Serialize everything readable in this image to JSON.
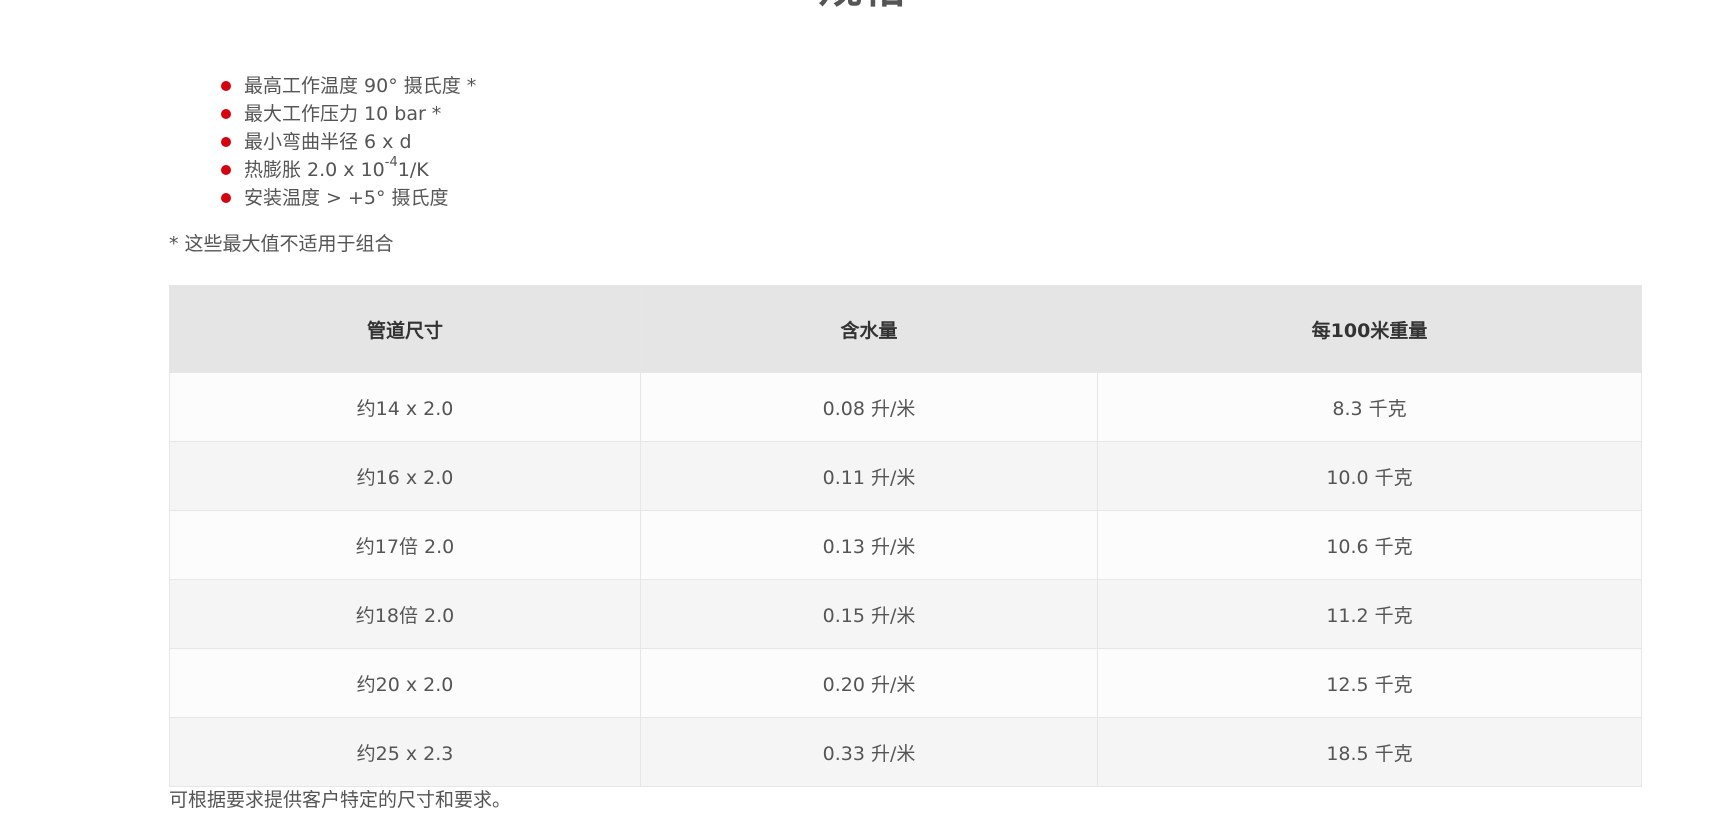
{
  "heading": "规格",
  "specs": {
    "item1": "最高工作温度 90° 摄氏度 *",
    "item2": "最大工作压力 10 bar *",
    "item3": "最小弯曲半径 6 x d",
    "item4_prefix": "热膨胀 2.0 x 10",
    "item4_exp": "-4",
    "item4_suffix": "1/K",
    "item5": "安装温度 > +5° 摄氏度",
    "bullet_color": "#d7000f"
  },
  "footnote": "* 这些最大值不适用于组合",
  "table": {
    "headers": [
      "管道尺寸",
      "含水量",
      "每100米重量"
    ],
    "rows": [
      [
        "约14 x 2.0",
        "0.08 升/米",
        "8.3 千克"
      ],
      [
        "约16 x 2.0",
        "0.11 升/米",
        "10.0 千克"
      ],
      [
        "约17倍 2.0",
        "0.13 升/米",
        "10.6 千克"
      ],
      [
        "约18倍 2.0",
        "0.15 升/米",
        "11.2 千克"
      ],
      [
        "约20 x 2.0",
        "0.20 升/米",
        "12.5 千克"
      ],
      [
        "约25 x 2.3",
        "0.33 升/米",
        "18.5 千克"
      ]
    ]
  },
  "bottom_note": "可根据要求提供客户特定的尺寸和要求。"
}
